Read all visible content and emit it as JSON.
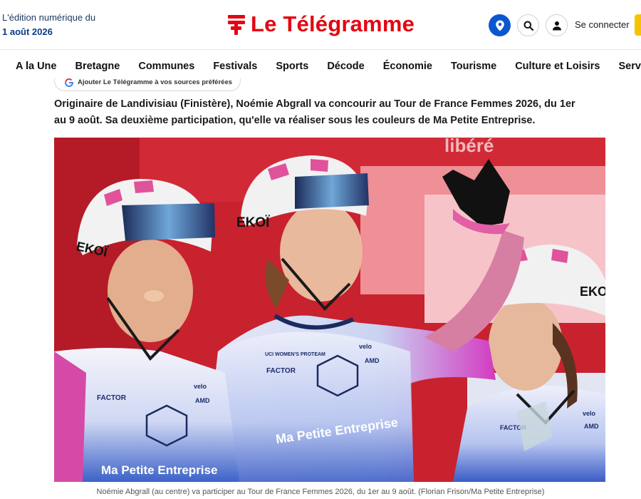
{
  "header": {
    "edition_label": "L'édition numérique du",
    "edition_date": "1 août 2026",
    "logo_text": "Le Télégramme",
    "connect_label": "Se connecter",
    "brand_color": "#e30613"
  },
  "nav": {
    "items": [
      "A la Une",
      "Bretagne",
      "Communes",
      "Festivals",
      "Sports",
      "Décode",
      "Économie",
      "Tourisme",
      "Culture et Loisirs",
      "Services"
    ]
  },
  "google_source_label": "Ajouter Le Télégramme à vos sources préférées",
  "article": {
    "lead": "Originaire de Landivisiau (Finistère), Noémie Abgrall va concourir au Tour de France Femmes 2026, du 1er au 9 août. Sa deuxième participation, qu'elle va réaliser sous les couleurs de Ma Petite Entreprise.",
    "photo_caption": "Noémie Abgrall (au centre) va participer au Tour de France Femmes 2026, du 1er au 9 août. (Florian Frison/Ma Petite Entreprise)",
    "photo_texts": {
      "helmet_brand": "EKOÏ",
      "team_name": "Ma Petite Entreprise",
      "sponsor_factor": "FACTOR",
      "sponsor_velo": "velo",
      "sponsor_amd": "AMD",
      "uci_label": "UCI WOMEN'S PROTEAM",
      "banner_word": "libéré"
    }
  }
}
